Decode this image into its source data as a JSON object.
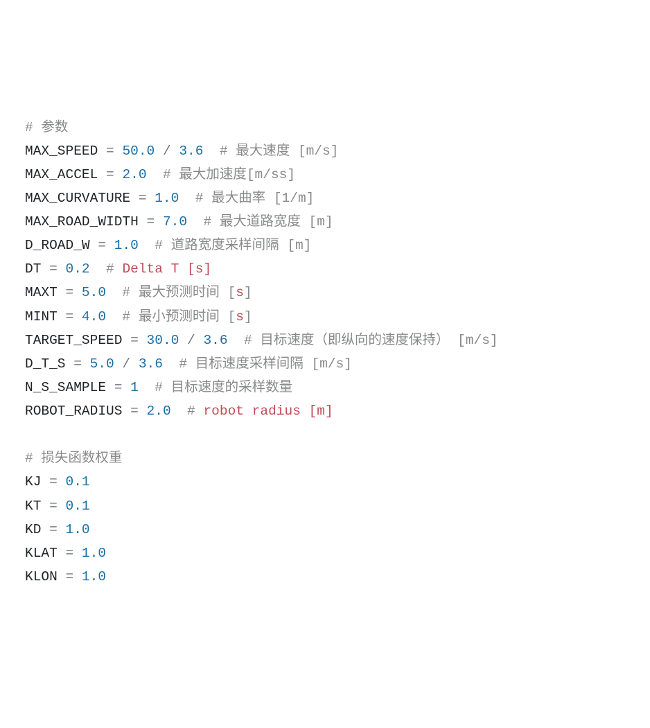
{
  "lines": [
    {
      "type": "comment",
      "prefix": "# ",
      "text": "参数"
    },
    {
      "type": "assign",
      "id": "MAX_SPEED",
      "eq": " = ",
      "parts": [
        {
          "kind": "num",
          "v": "50.0"
        },
        {
          "kind": "op",
          "v": " / "
        },
        {
          "kind": "num",
          "v": "3.6"
        }
      ],
      "cprefix": "  # ",
      "comment": "最大速度 [m/s]"
    },
    {
      "type": "assign",
      "id": "MAX_ACCEL",
      "eq": " = ",
      "parts": [
        {
          "kind": "num",
          "v": "2.0"
        }
      ],
      "cprefix": "  # ",
      "comment": "最大加速度[m/ss]"
    },
    {
      "type": "assign",
      "id": "MAX_CURVATURE",
      "eq": " = ",
      "parts": [
        {
          "kind": "num",
          "v": "1.0"
        }
      ],
      "cprefix": "  # ",
      "comment": "最大曲率 [1/m]"
    },
    {
      "type": "assign",
      "id": "MAX_ROAD_WIDTH",
      "eq": " = ",
      "parts": [
        {
          "kind": "num",
          "v": "7.0"
        }
      ],
      "cprefix": "  # ",
      "comment": "最大道路宽度 [m]"
    },
    {
      "type": "assign",
      "id": "D_ROAD_W",
      "eq": " = ",
      "parts": [
        {
          "kind": "num",
          "v": "1.0"
        }
      ],
      "cprefix": "  # ",
      "comment": "道路宽度采样间隔 [m]"
    },
    {
      "type": "assign",
      "id": "DT",
      "eq": " = ",
      "parts": [
        {
          "kind": "num",
          "v": "0.2"
        }
      ],
      "cprefix": "  # ",
      "comment_red": "Delta T [s]"
    },
    {
      "type": "assign",
      "id": "MAXT",
      "eq": " = ",
      "parts": [
        {
          "kind": "num",
          "v": "5.0"
        }
      ],
      "cprefix": "  # ",
      "comment": "最大预测时间 [",
      "comment_red": "s",
      "comment_tail": "]"
    },
    {
      "type": "assign",
      "id": "MINT",
      "eq": " = ",
      "parts": [
        {
          "kind": "num",
          "v": "4.0"
        }
      ],
      "cprefix": "  # ",
      "comment": "最小预测时间 [",
      "comment_red": "s",
      "comment_tail": "]"
    },
    {
      "type": "assign",
      "id": "TARGET_SPEED",
      "eq": " = ",
      "parts": [
        {
          "kind": "num",
          "v": "30.0"
        },
        {
          "kind": "op",
          "v": " / "
        },
        {
          "kind": "num",
          "v": "3.6"
        }
      ],
      "cprefix": "  # ",
      "comment": "目标速度（即纵向的速度保持） [m/s]"
    },
    {
      "type": "assign",
      "id": "D_T_S",
      "eq": " = ",
      "parts": [
        {
          "kind": "num",
          "v": "5.0"
        },
        {
          "kind": "op",
          "v": " / "
        },
        {
          "kind": "num",
          "v": "3.6"
        }
      ],
      "cprefix": "  # ",
      "comment": "目标速度采样间隔 [m/s]"
    },
    {
      "type": "assign",
      "id": "N_S_SAMPLE",
      "eq": " = ",
      "parts": [
        {
          "kind": "num",
          "v": "1"
        }
      ],
      "cprefix": "  # ",
      "comment": "目标速度的采样数量"
    },
    {
      "type": "assign",
      "id": "ROBOT_RADIUS",
      "eq": " = ",
      "parts": [
        {
          "kind": "num",
          "v": "2.0"
        }
      ],
      "cprefix": "  # ",
      "comment_red": "robot radius [m]"
    },
    {
      "type": "blank"
    },
    {
      "type": "comment",
      "prefix": "# ",
      "text": "损失函数权重"
    },
    {
      "type": "assign",
      "id": "KJ",
      "eq": " = ",
      "parts": [
        {
          "kind": "num",
          "v": "0.1"
        }
      ]
    },
    {
      "type": "assign",
      "id": "KT",
      "eq": " = ",
      "parts": [
        {
          "kind": "num",
          "v": "0.1"
        }
      ]
    },
    {
      "type": "assign",
      "id": "KD",
      "eq": " = ",
      "parts": [
        {
          "kind": "num",
          "v": "1.0"
        }
      ]
    },
    {
      "type": "assign",
      "id": "KLAT",
      "eq": " = ",
      "parts": [
        {
          "kind": "num",
          "v": "1.0"
        }
      ]
    },
    {
      "type": "assign",
      "id": "KLON",
      "eq": " = ",
      "parts": [
        {
          "kind": "num",
          "v": "1.0"
        }
      ]
    }
  ]
}
